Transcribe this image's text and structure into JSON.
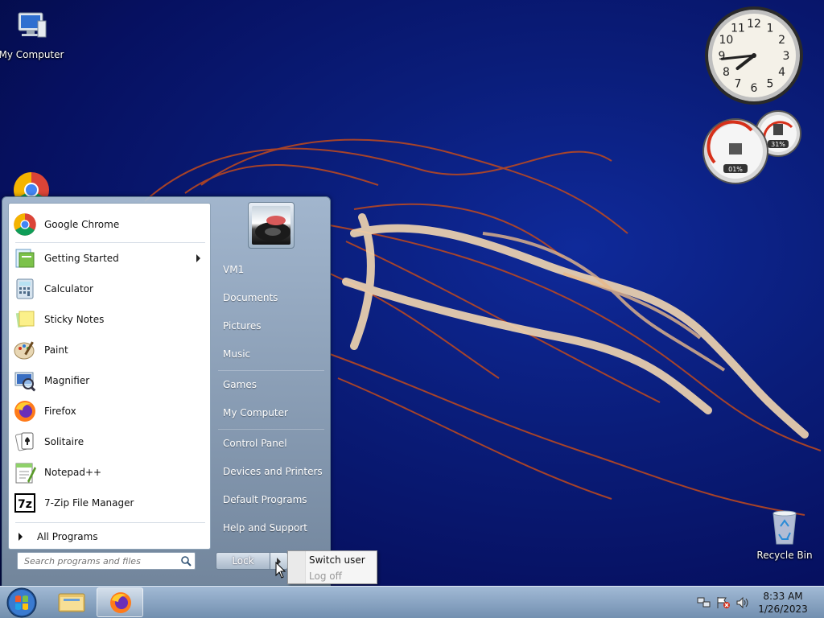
{
  "desktop": {
    "icons": [
      {
        "label": "My Computer",
        "icon": "computer-icon"
      },
      {
        "label": "Recycle Bin",
        "icon": "recycle-bin-icon"
      },
      {
        "label": "",
        "icon": "chrome-icon"
      }
    ]
  },
  "gadgets": {
    "clock": {
      "hour": 7,
      "minute": 44,
      "numbers": [
        "12",
        "1",
        "2",
        "3",
        "4",
        "5",
        "6",
        "7",
        "8",
        "9",
        "10",
        "11"
      ]
    },
    "meters": {
      "cpu": "01%",
      "memory": "31%"
    }
  },
  "start_menu": {
    "programs": [
      {
        "label": "Google Chrome",
        "icon": "chrome-icon"
      },
      {
        "label": "Getting Started",
        "icon": "getting-started-icon",
        "submenu": true
      },
      {
        "label": "Calculator",
        "icon": "calculator-icon"
      },
      {
        "label": "Sticky Notes",
        "icon": "sticky-notes-icon"
      },
      {
        "label": "Paint",
        "icon": "paint-icon"
      },
      {
        "label": "Magnifier",
        "icon": "magnifier-icon"
      },
      {
        "label": "Firefox",
        "icon": "firefox-icon"
      },
      {
        "label": "Solitaire",
        "icon": "solitaire-icon"
      },
      {
        "label": "Notepad++",
        "icon": "notepadpp-icon"
      },
      {
        "label": "7-Zip File Manager",
        "icon": "7zip-icon"
      }
    ],
    "all_programs": "All Programs",
    "search_placeholder": "Search programs and files",
    "right_items": {
      "user": "VM1",
      "documents": "Documents",
      "pictures": "Pictures",
      "music": "Music",
      "games": "Games",
      "computer": "My Computer",
      "control_panel": "Control Panel",
      "devices": "Devices and Printers",
      "default_programs": "Default Programs",
      "help": "Help and Support"
    },
    "lock_label": "Lock",
    "popup": {
      "switch_user": "Switch user",
      "log_off": "Log off"
    }
  },
  "taskbar": {
    "time": "8:33 AM",
    "date": "1/26/2023"
  },
  "colors": {
    "wallpaper_blue": "#0a1d7a",
    "taskbar": "#9ab4cf",
    "accent_red": "#d6301a"
  }
}
